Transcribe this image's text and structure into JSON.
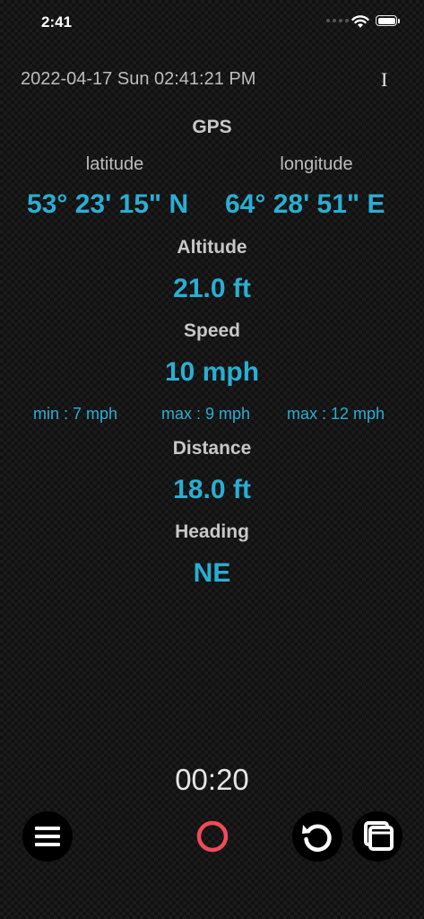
{
  "status_bar": {
    "time": "2:41"
  },
  "header": {
    "datetime": "2022-04-17 Sun 02:41:21 PM",
    "cursor_glyph": "I"
  },
  "gps": {
    "title": "GPS",
    "latitude_label": "latitude",
    "longitude_label": "longitude",
    "latitude_value": "53° 23' 15\" N",
    "longitude_value": "64° 28' 51\" E"
  },
  "altitude": {
    "title": "Altitude",
    "value": "21.0 ft"
  },
  "speed": {
    "title": "Speed",
    "value": "10 mph",
    "min": "min : 7 mph",
    "max": "max : 9 mph",
    "max2": "max : 12 mph"
  },
  "distance": {
    "title": "Distance",
    "value": "18.0 ft"
  },
  "heading": {
    "title": "Heading",
    "value": "NE"
  },
  "timer": "00:20",
  "toolbar": {
    "icons": [
      "menu-icon",
      "record-icon",
      "reset-icon",
      "windows-icon"
    ]
  },
  "colors": {
    "accent": "#2aaed2",
    "record": "#f04a5a",
    "label": "#c8c8c8"
  }
}
